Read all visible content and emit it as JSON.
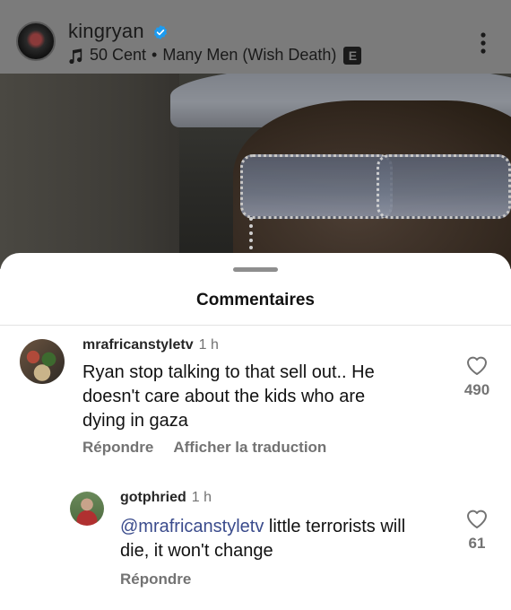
{
  "post": {
    "username": "kingryan",
    "song_artist": "50 Cent",
    "separator": "•",
    "song_title": "Many Men (Wish Death)",
    "explicit_badge": "E"
  },
  "icons": {
    "verified": "verified-badge-icon",
    "music": "music-note-icon",
    "more": "more-vertical-icon",
    "heart": "heart-outline-icon"
  },
  "colors": {
    "verified_blue": "#1d9bf0",
    "mention": "#3a4b8c",
    "secondary_text": "#737373"
  },
  "sheet": {
    "title": "Commentaires"
  },
  "comments": [
    {
      "username": "mrafricanstyletv",
      "time": "1 h",
      "text_lines": [
        "Ryan stop talking to that sell out.. He",
        "doesn't care about the kids who are",
        "dying in gaza"
      ],
      "likes": "490",
      "reply_label": "Répondre",
      "translate_label": "Afficher la traduction"
    },
    {
      "username": "gotphried",
      "time": "1 h",
      "mention": "@mrafricanstyletv",
      "text_line1_rest": " little terrorists will",
      "text_line2": "die, it won't change",
      "likes": "61",
      "reply_label": "Répondre"
    }
  ]
}
